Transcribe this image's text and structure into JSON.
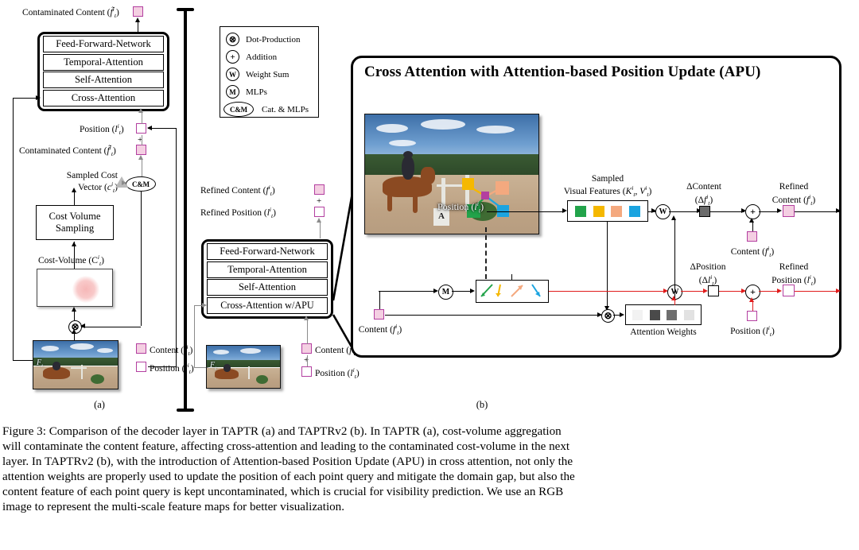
{
  "figure": {
    "panel_a_label": "(a)",
    "panel_b_label": "(b)",
    "panel_b_title_parts": [
      "Cross Attention with ",
      "A",
      "ttention-based ",
      "P",
      "osition ",
      "U",
      "pdate (APU)"
    ],
    "panel_b_title": "Cross Attention with Attention-based Position Update (APU)"
  },
  "legend": {
    "items": [
      {
        "symbol": "⊗",
        "icon": "dot-product-icon",
        "label": "Dot-Production"
      },
      {
        "symbol": "+",
        "icon": "addition-icon",
        "label": "Addition"
      },
      {
        "symbol": "W",
        "icon": "weight-sum-icon",
        "label": "Weight Sum"
      },
      {
        "symbol": "M",
        "icon": "mlp-icon",
        "label": "MLPs"
      },
      {
        "symbol": "C&M",
        "icon": "cat-mlp-icon",
        "label": "Cat. & MLPs"
      }
    ]
  },
  "panel_a": {
    "top_output": "Contaminated Content (f̃ᵢᵗ)",
    "top_output_text": "Contaminated Content (",
    "decoder_blocks": [
      "Feed-Forward-Network",
      "Temporal-Attention",
      "Self-Attention",
      "Cross-Attention"
    ],
    "position_label": "Position (",
    "contaminated_label": "Contaminated Content (",
    "plus": "+",
    "sampled_cost_vector_l1": "Sampled Cost",
    "sampled_cost_vector_l2": "Vector (",
    "cost_volume_sampling_l1": "Cost Volume",
    "cost_volume_sampling_l2": "Sampling",
    "cost_volume_label": "Cost-Volume (C",
    "content_label": "Content (",
    "frame_tag": "F",
    "cm_op": "C&M",
    "dot_op": "⊗"
  },
  "panel_b_left": {
    "refined_content": "Refined Content (",
    "refined_position": "Refined Position (",
    "plus": "+",
    "decoder_blocks": [
      "Feed-Forward-Network",
      "Temporal-Attention",
      "Self-Attention",
      "Cross-Attention w/APU"
    ],
    "content_label": "Content (",
    "position_label": "Position (",
    "frame_tag": "F"
  },
  "panel_b": {
    "position_on_image": "Position (",
    "sampled_visual_features_l1": "Sampled",
    "sampled_visual_features_l2": "Visual Features (K",
    "delta_content_l1": "ΔContent",
    "delta_content_l2": "(Δf",
    "refined_content_l1": "Refined",
    "refined_content_l2": "Content (f",
    "content_label": "Content (f",
    "delta_position_l1": "ΔPosition",
    "delta_position_l2": "(Δl",
    "refined_position_l1": "Refined",
    "refined_position_l2": "Position (l",
    "position_label": "Position (l",
    "attention_weights": "Attention Weights",
    "content_input": "Content (f",
    "mlp_op": "M",
    "weight_sum_op": "W",
    "dot_op": "⊗",
    "plus_op": "+"
  },
  "colors": {
    "token_border": "#b33fa0",
    "token_fill": "#f4cfe2",
    "position_path": "#e01b1b",
    "feature_green": "#22a34a",
    "feature_yellow": "#f5b800",
    "feature_peach": "#f4a97f",
    "feature_blue": "#1ba4e0",
    "attn_w1": "#f2f2f2",
    "attn_w2": "#4a4a4a",
    "attn_w3": "#6e6e6e",
    "attn_w4": "#e2e2e2",
    "delta_content_fill": "#6b6b6b"
  },
  "chart_data": {
    "type": "table",
    "title": "Sampled Visual Features / Attention Weights",
    "feature_colors": [
      "#22a34a",
      "#f5b800",
      "#f4a97f",
      "#1ba4e0"
    ],
    "attention_weight_values": [
      0.05,
      0.72,
      0.52,
      0.12
    ],
    "attention_weight_colors": [
      "#f2f2f2",
      "#4a4a4a",
      "#6e6e6e",
      "#e2e2e2"
    ]
  },
  "caption": {
    "lines": [
      "Figure 3: Comparison of the decoder layer in TAPTR (a) and TAPTRv2 (b). In TAPTR (a), cost-volume aggregation",
      "will contaminate the content feature, affecting cross-attention and leading to the contaminated cost-volume in the next",
      "layer. In TAPTRv2 (b), with the introduction of Attention-based Position Update (APU) in cross attention, not only the",
      "attention weights are properly used to update the position of each point query and mitigate the domain gap, but also the",
      "content feature of each point query is kept uncontaminated, which is crucial for visibility prediction. We use an RGB",
      "image to represent the multi-scale feature maps for better visualization."
    ]
  }
}
